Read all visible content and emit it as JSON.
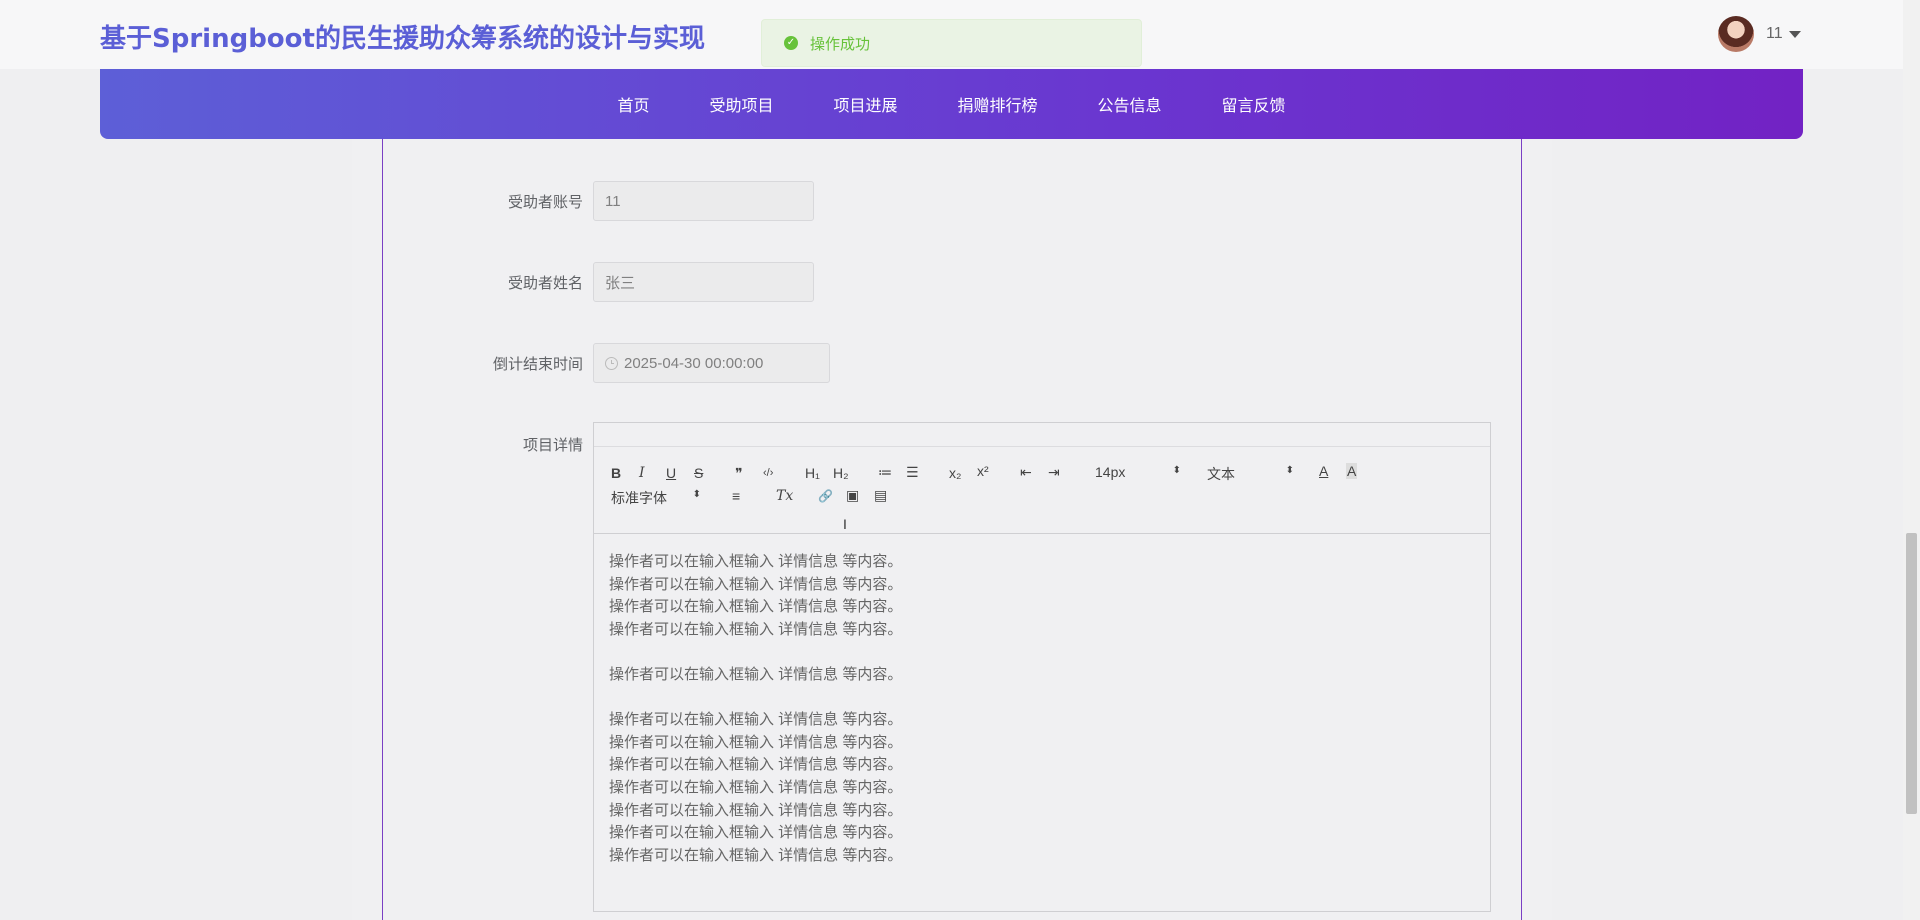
{
  "header": {
    "title": "基于Springboot的民生援助众筹系统的设计与实现",
    "user_name": "11"
  },
  "toast": {
    "message": "操作成功",
    "type": "success"
  },
  "nav": {
    "items": [
      "首页",
      "受助项目",
      "项目进展",
      "捐赠排行榜",
      "公告信息",
      "留言反馈"
    ]
  },
  "form": {
    "account_label": "受助者账号",
    "account_value": "11",
    "name_label": "受助者姓名",
    "name_value": "张三",
    "deadline_label": "倒计结束时间",
    "deadline_value": "2025-04-30 00:00:00",
    "detail_label": "项目详情"
  },
  "editor": {
    "toolbar": {
      "bold": "B",
      "italic": "I",
      "underline": "U",
      "strike": "S",
      "quote": "❞",
      "code": "‹/›",
      "h1": "H₁",
      "h2": "H₂",
      "ordered_list": "≔",
      "bullet_list": "☰",
      "subscript": "x₂",
      "superscript": "x²",
      "outdent": "⇤",
      "indent": "⇥",
      "size": "14px",
      "header": "文本",
      "font": "标准字体",
      "align": "≡",
      "clean": "Tx",
      "link": "🔗",
      "image": "▣",
      "video": "▤"
    },
    "lines": [
      "操作者可以在输入框输入  详情信息  等内容。",
      "操作者可以在输入框输入  详情信息  等内容。",
      "操作者可以在输入框输入  详情信息  等内容。",
      "操作者可以在输入框输入  详情信息  等内容。",
      "",
      "操作者可以在输入框输入  详情信息  等内容。",
      "",
      "操作者可以在输入框输入  详情信息  等内容。",
      "操作者可以在输入框输入  详情信息  等内容。",
      "操作者可以在输入框输入  详情信息  等内容。",
      "操作者可以在输入框输入  详情信息  等内容。",
      "操作者可以在输入框输入  详情信息  等内容。",
      "操作者可以在输入框输入  详情信息  等内容。",
      "操作者可以在输入框输入  详情信息  等内容。"
    ]
  },
  "colors": {
    "title": "#5b5fd6",
    "nav_gradient_start": "#5d5fd7",
    "nav_gradient_end": "#7222c4",
    "success": "#67c23a"
  }
}
